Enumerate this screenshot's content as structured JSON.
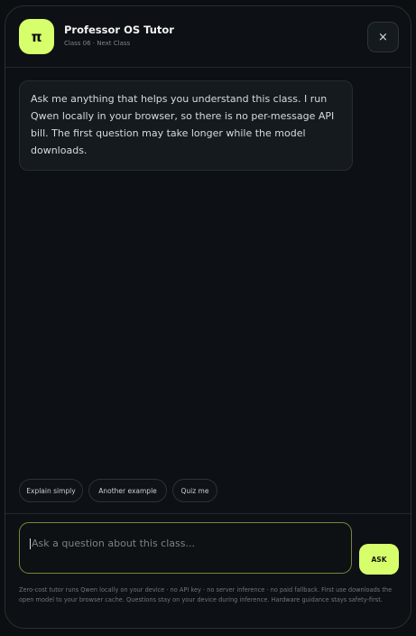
{
  "header": {
    "avatar_glyph": "π",
    "title": "Professor OS Tutor",
    "subtitle": "Class 06 · Next Class",
    "close_glyph": "×"
  },
  "messages": [
    {
      "role": "tutor",
      "text": "Ask me anything that helps you understand this class. I run Qwen locally in your browser, so there is no per-message API bill. The first question may take longer while the model downloads."
    }
  ],
  "suggestions": [
    "Explain simply",
    "Another example",
    "Quiz me"
  ],
  "composer": {
    "placeholder": "Ask a question about this class...",
    "value": "",
    "ask_label": "ASK"
  },
  "footer_note": "Zero-cost tutor runs Qwen locally on your device · no API key · no server inference · no paid fallback. First use downloads the open model to your browser cache. Questions stay on your device during inference. Hardware guidance stays safety-first.",
  "colors": {
    "accent": "#d7ff6b",
    "background": "#0d1014",
    "input_border": "#78863b"
  },
  "icons": {
    "avatar": "pi-icon",
    "close": "close-icon"
  }
}
